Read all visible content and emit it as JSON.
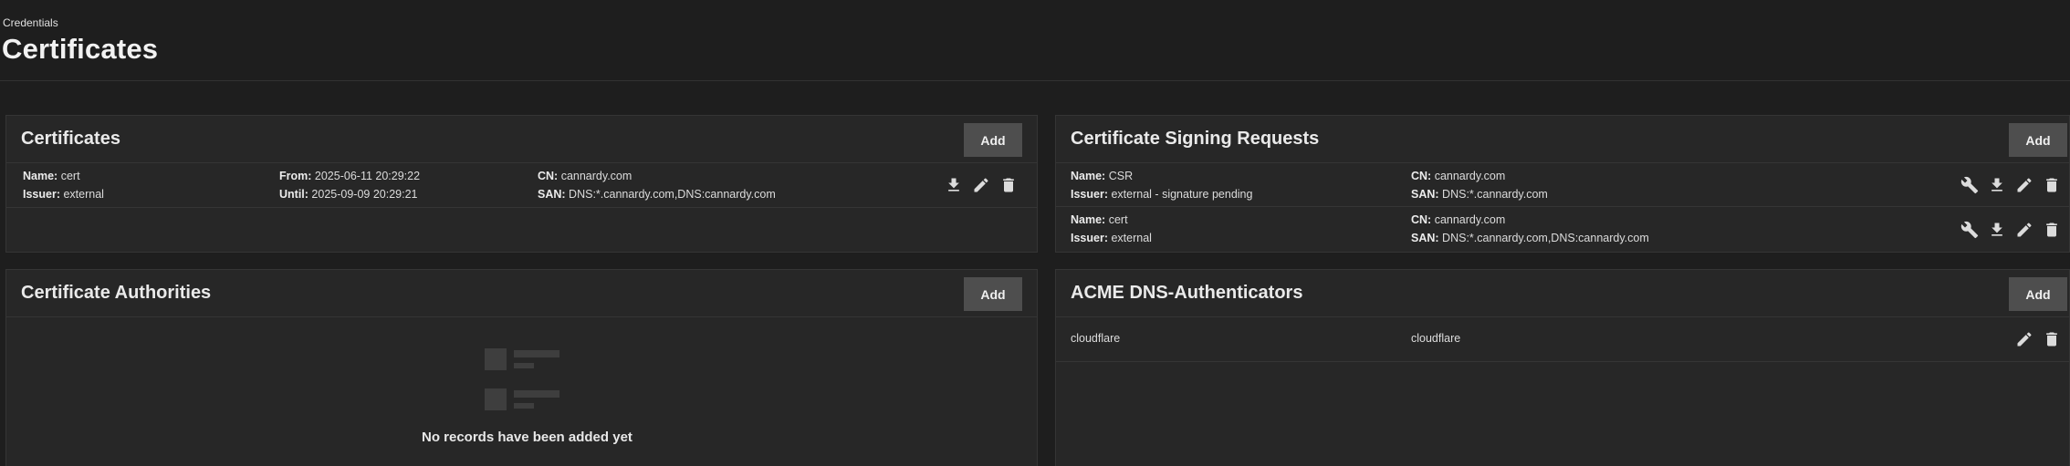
{
  "header": {
    "breadcrumb": "Credentials",
    "title": "Certificates"
  },
  "certificates": {
    "title": "Certificates",
    "add_label": "Add",
    "rows": [
      {
        "name_label": "Name:",
        "name": "cert",
        "issuer_label": "Issuer:",
        "issuer": "external",
        "from_label": "From:",
        "from": "2025-06-11 20:29:22",
        "until_label": "Until:",
        "until": "2025-09-09 20:29:21",
        "cn_label": "CN:",
        "cn": "cannardy.com",
        "san_label": "SAN:",
        "san": "DNS:*.cannardy.com,DNS:cannardy.com",
        "actions": [
          "download-icon",
          "edit-icon",
          "delete-icon"
        ]
      }
    ]
  },
  "csr": {
    "title": "Certificate Signing Requests",
    "add_label": "Add",
    "rows": [
      {
        "name_label": "Name:",
        "name": "CSR",
        "issuer_label": "Issuer:",
        "issuer": "external - signature pending",
        "cn_label": "CN:",
        "cn": "cannardy.com",
        "san_label": "SAN:",
        "san": "DNS:*.cannardy.com",
        "actions": [
          "wrench-icon",
          "download-icon",
          "edit-icon",
          "delete-icon"
        ]
      },
      {
        "name_label": "Name:",
        "name": "cert",
        "issuer_label": "Issuer:",
        "issuer": "external",
        "cn_label": "CN:",
        "cn": "cannardy.com",
        "san_label": "SAN:",
        "san": "DNS:*.cannardy.com,DNS:cannardy.com",
        "actions": [
          "wrench-icon",
          "download-icon",
          "edit-icon",
          "delete-icon"
        ]
      }
    ]
  },
  "authorities": {
    "title": "Certificate Authorities",
    "add_label": "Add",
    "empty_text": "No records have been added yet"
  },
  "acme": {
    "title": "ACME DNS-Authenticators",
    "add_label": "Add",
    "rows": [
      {
        "name": "cloudflare",
        "authenticator": "cloudflare",
        "actions": [
          "edit-icon",
          "delete-icon"
        ]
      }
    ]
  }
}
